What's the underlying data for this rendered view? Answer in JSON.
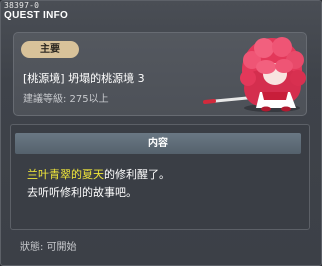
{
  "window": {
    "id_text": "38397-0",
    "title": "QUEST INFO"
  },
  "quest": {
    "badge": "主要",
    "name": "[桃源境] 坍塌的桃源境 3",
    "level": "建議等級: 275以上"
  },
  "content": {
    "header": "内容",
    "highlight_name": "兰叶青翠的夏天",
    "line1_rest": "的修利醒了。",
    "line2": "去听听修利的故事吧。"
  },
  "status": "狀態: 可開始",
  "colors": {
    "highlight": "#f2e83a",
    "badge": "#d8c29a",
    "header": "#627180"
  },
  "icons": {
    "npc": "pink-haired-character-icon"
  }
}
